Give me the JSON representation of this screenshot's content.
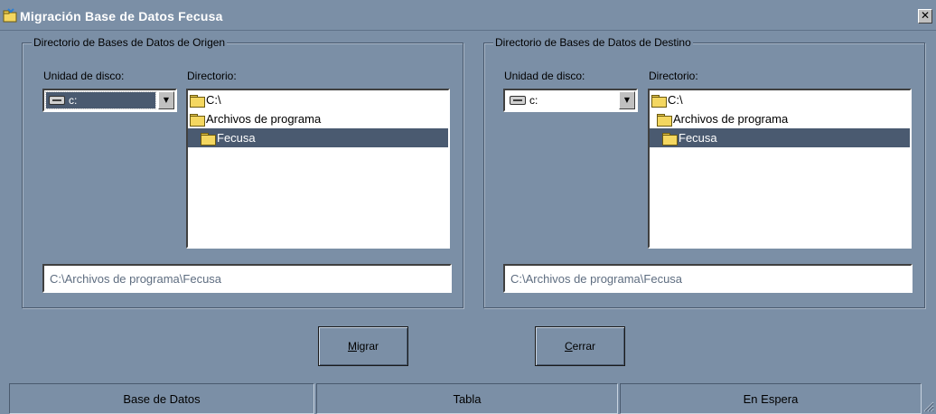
{
  "window": {
    "title": "Migración Base de Datos Fecusa",
    "close_glyph": "✕"
  },
  "source": {
    "legend": "Directorio de Bases de Datos de Origen",
    "drive_label": "Unidad de disco:",
    "drive_value": "c:",
    "dir_label": "Directorio:",
    "dirs": [
      "C:\\",
      "Archivos de programa",
      "Fecusa"
    ],
    "path": "C:\\Archivos de programa\\Fecusa"
  },
  "destination": {
    "legend": "Directorio de Bases de Datos de Destino",
    "drive_label": "Unidad de disco:",
    "drive_value": "c:",
    "dir_label": "Directorio:",
    "dirs": [
      "C:\\",
      "Archivos de programa",
      "Fecusa"
    ],
    "path": "C:\\Archivos de programa\\Fecusa"
  },
  "buttons": {
    "migrar_access": "M",
    "migrar_rest": "igrar",
    "cerrar_access": "C",
    "cerrar_rest": "errar"
  },
  "statusbar": {
    "panels": [
      "Base de Datos",
      "Tabla",
      "En Espera"
    ]
  },
  "colors": {
    "background": "#7b8fa6",
    "selection": "#4a5a70"
  }
}
